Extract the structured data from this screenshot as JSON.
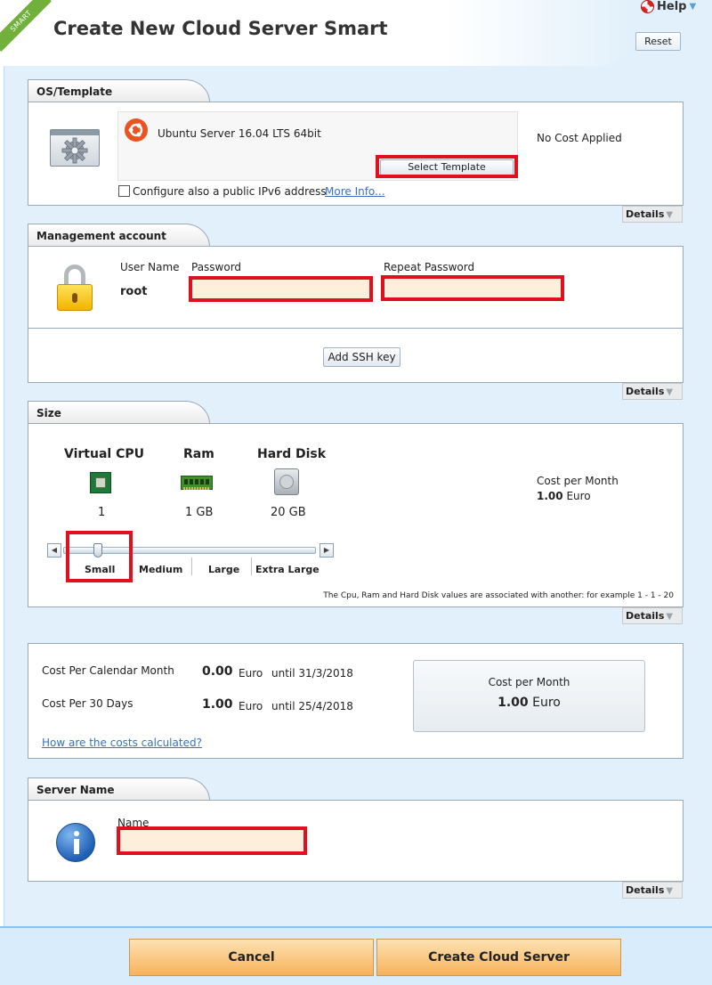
{
  "header": {
    "ribbon": "SMART",
    "title": "Create New Cloud Server Smart",
    "help_label": "Help",
    "reset_label": "Reset"
  },
  "os_template": {
    "tab": "OS/Template",
    "os_name": "Ubuntu Server 16.04 LTS 64bit",
    "select_template_label": "Select Template",
    "cost_text": "No Cost Applied",
    "ipv6_label": "Configure also a public IPv6 address",
    "more_info_link": "More Info...",
    "ipv6_checked": false,
    "details_label": "Details"
  },
  "management": {
    "tab": "Management account",
    "username_label": "User Name",
    "username_value": "root",
    "password_label": "Password",
    "password_value": "",
    "repeat_password_label": "Repeat Password",
    "repeat_password_value": "",
    "add_ssh_label": "Add SSH key",
    "details_label": "Details"
  },
  "size": {
    "tab": "Size",
    "cpu_label": "Virtual CPU",
    "cpu_value": "1",
    "ram_label": "Ram",
    "ram_value": "1 GB",
    "disk_label": "Hard Disk",
    "disk_value": "20 GB",
    "cost_label": "Cost per Month",
    "cost_amount": "1.00",
    "cost_currency": "Euro",
    "slider_options": [
      "Small",
      "Medium",
      "Large",
      "Extra Large"
    ],
    "slider_selected": "Small",
    "note": "The Cpu, Ram and Hard Disk values are associated with another: for example 1 - 1 - 20",
    "details_label": "Details"
  },
  "costs": {
    "calendar_label": "Cost Per Calendar Month",
    "calendar_amount": "0.00",
    "calendar_currency": "Euro",
    "calendar_until": "until 31/3/2018",
    "days30_label": "Cost Per 30 Days",
    "days30_amount": "1.00",
    "days30_currency": "Euro",
    "days30_until": "until 25/4/2018",
    "how_link": "How are the costs calculated?",
    "box_label": "Cost per Month",
    "box_amount": "1.00",
    "box_currency": "Euro"
  },
  "server_name": {
    "tab": "Server Name",
    "name_label": "Name",
    "name_value": "",
    "details_label": "Details"
  },
  "footer": {
    "cancel_label": "Cancel",
    "create_label": "Create Cloud Server"
  },
  "colors": {
    "highlight_red": "#e0101e",
    "input_fill": "#fdefdc",
    "page_bg": "#e1f0fb",
    "footer_button": "#f7b25a",
    "link": "#3a6fc4"
  }
}
